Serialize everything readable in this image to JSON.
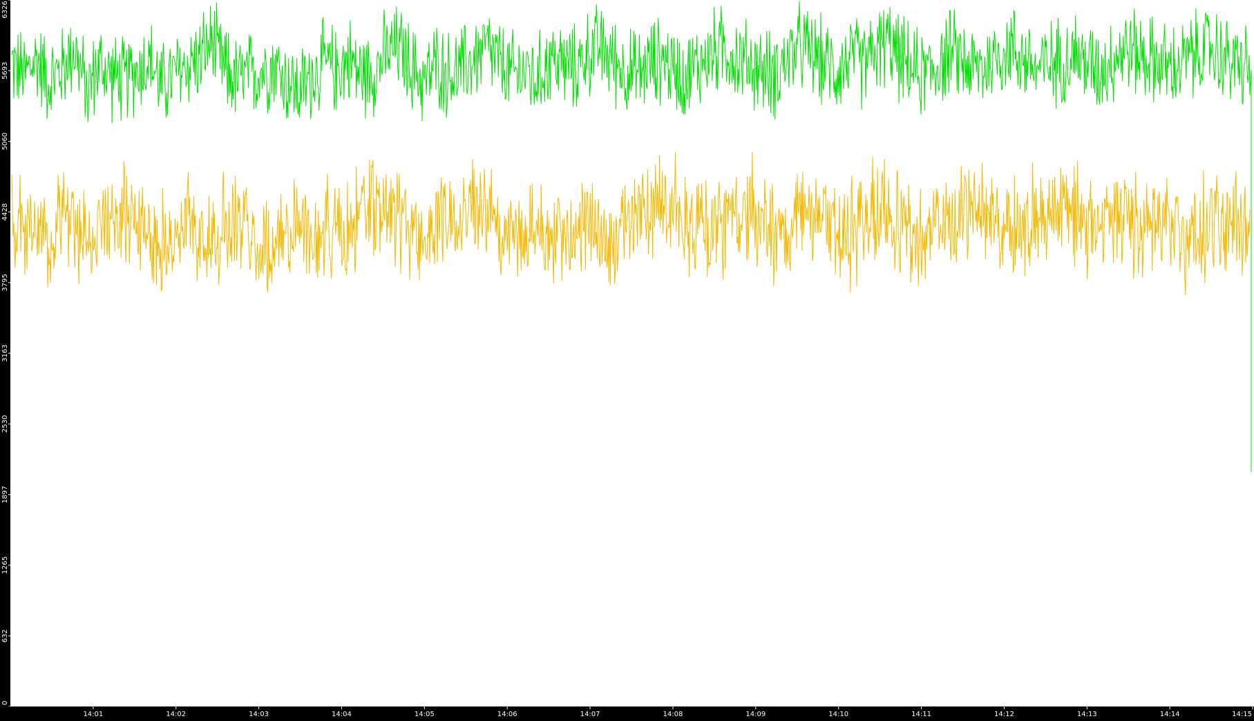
{
  "chart_data": {
    "type": "line",
    "title": "",
    "xlabel": "",
    "ylabel": "",
    "background": "#ffffff",
    "axis_background": "#000000",
    "axis_text_color": "#ffffff",
    "grid": false,
    "x_range": [
      "14:00",
      "14:15"
    ],
    "ylim": [
      0,
      6326
    ],
    "y_ticks": [
      0,
      632,
      1265,
      1897,
      2530,
      3163,
      3795,
      4428,
      5060,
      5693,
      6326
    ],
    "x_ticks": [
      "14:01",
      "14:02",
      "14:03",
      "14:04",
      "14:05",
      "14:06",
      "14:07",
      "14:08",
      "14:09",
      "14:10",
      "14:11",
      "14:12",
      "14:13",
      "14:14",
      "14:15"
    ],
    "series": [
      {
        "color": "#00e000",
        "mean": 5700,
        "min_approx": 4700,
        "max_approx": 6326,
        "final_drop": 2100,
        "values": [
          5750,
          5650,
          5800,
          5600,
          5700,
          5900,
          5500,
          5750,
          5650,
          5600,
          5700,
          5800,
          5550,
          5650,
          5750,
          5800,
          5950,
          5700,
          5600,
          5650,
          5700,
          5750,
          5600,
          5500,
          5650,
          5750,
          5700,
          5800,
          5650,
          5700,
          5850,
          5900,
          5700,
          5600,
          5750,
          5650,
          5700,
          5800,
          5900,
          5750,
          5650,
          5700,
          5600,
          5800,
          5750,
          5700,
          5850,
          5900,
          5800,
          5700,
          5650,
          5750,
          5800,
          5700,
          5650,
          5750,
          5850,
          5900,
          5800,
          5750,
          5700,
          5650,
          5800,
          5900,
          5850,
          5750,
          5700,
          5800,
          5750,
          5850,
          5950,
          5800,
          5700,
          5650,
          5750,
          5850,
          5800,
          5700,
          5750,
          5850,
          5900,
          5800,
          5700,
          5750,
          5800,
          5850,
          5750,
          5700,
          5800,
          5900,
          5850,
          5800,
          5750,
          5700,
          5800,
          5850,
          5900,
          5800,
          5750,
          5700
        ]
      },
      {
        "color": "#f5b800",
        "mean": 4300,
        "min_approx": 3200,
        "max_approx": 5100,
        "values": [
          4350,
          4200,
          4400,
          4100,
          4500,
          4300,
          4250,
          4150,
          4400,
          4350,
          4450,
          4300,
          4200,
          4100,
          4350,
          4250,
          4150,
          4300,
          4400,
          4200,
          4100,
          4050,
          4250,
          4350,
          4200,
          4300,
          4150,
          4250,
          4400,
          4500,
          4450,
          4350,
          4250,
          4200,
          4300,
          4400,
          4500,
          4550,
          4400,
          4300,
          4250,
          4200,
          4350,
          4250,
          4150,
          4300,
          4400,
          4200,
          4100,
          4250,
          4350,
          4500,
          4600,
          4450,
          4300,
          4200,
          4350,
          4250,
          4400,
          4500,
          4350,
          4250,
          4200,
          4400,
          4300,
          4350,
          4250,
          4200,
          4300,
          4450,
          4400,
          4300,
          4200,
          4250,
          4350,
          4300,
          4400,
          4500,
          4450,
          4350,
          4300,
          4250,
          4400,
          4500,
          4550,
          4400,
          4300,
          4350,
          4450,
          4400,
          4300,
          4250,
          4350,
          4300,
          4200,
          4250,
          4300,
          4350,
          4300,
          4250
        ]
      }
    ]
  }
}
